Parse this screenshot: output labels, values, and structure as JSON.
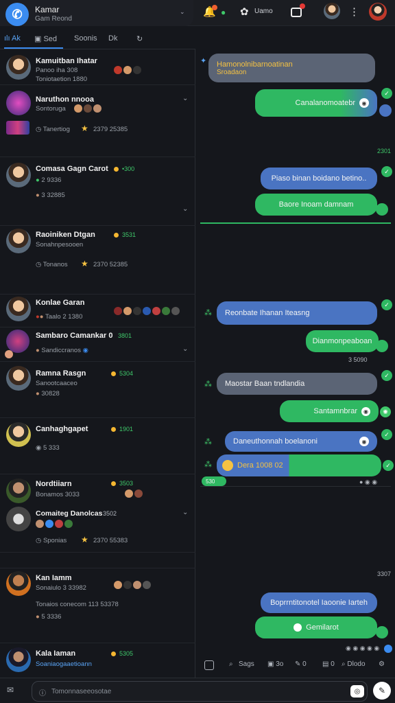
{
  "app": {
    "title": "Kamar",
    "subtitle": "Gam Reond"
  },
  "topbar": {
    "text1": "Uamo",
    "badge_color": "#e53935"
  },
  "tabs": [
    "Ak",
    "Sed",
    "Soonis",
    "Dk"
  ],
  "list": [
    {
      "name": "Kamuitban Ihatar",
      "line1": "Panoo iha 308",
      "line2": "Toniotaetion 1880"
    },
    {
      "name": "Naruthon nnooa",
      "line1": "Sontoruga",
      "meta": "Tanertiog",
      "stars": "2379 25385"
    },
    {
      "name": "Comasa Gagn Carot",
      "status": "•300",
      "line1": "2 9336",
      "line2": "3 32885"
    },
    {
      "name": "Raoiniken Dtgan",
      "status": "3531",
      "line1": "Sonahnpesooen",
      "meta": "Tonanos",
      "stars": "2370 52385"
    },
    {
      "name": "Konlae Garan",
      "line1": "Taalo 2 1380"
    },
    {
      "name": "Sambaro Camankar 0",
      "status": "3801",
      "line1": "Sandiccranos"
    },
    {
      "name": "Ramna Rasgn",
      "status": "5304",
      "line1": "Sanootcaaceo",
      "line2": "30828"
    },
    {
      "name": "Canhaghgapet",
      "status": "1901",
      "line1": "5 333"
    },
    {
      "name": "Nordtiiarn",
      "status": "3503",
      "line1": "Bonamos 3033"
    },
    {
      "name": "Comaiteg Danolcas",
      "status": "3502",
      "meta": "Sponias",
      "stars": "2370 55383"
    },
    {
      "name": "Kan Iamm",
      "line1": "Sonaiulo 3 33982",
      "line2": "Tonaios conecom 113 53378",
      "line3": "5 3336"
    },
    {
      "name": "Kala Iaman",
      "status": "5305",
      "line1": "Soaniaogaaetioann"
    }
  ],
  "chat": {
    "m1": "Hamonolnibarnoatinan",
    "m1b": "Sroadaon",
    "m2": "Canalanomoatebr",
    "meta1": "2301",
    "m3": "Piaso binan boidano betino..",
    "m4": "Baore Inoam damnam",
    "m5": "Reonbate Ihanan Iteasng",
    "m6": "Dianmonpeaboan",
    "meta2": "3 5090",
    "m7": "Maostar Baan tndlandia",
    "m8": "Santamnbrar",
    "m9": "Daneuthonnah boelanoni",
    "m10": "Dera 1008 02",
    "m10b": "530",
    "meta3": "3307",
    "m11": "Boprrntitonotel Iaoonie Iarteh",
    "m12": "Gemilarot"
  },
  "chatbar": {
    "a": "Sags",
    "b": "3o",
    "c": "0",
    "d": "Dlodo"
  },
  "composer": {
    "placeholder": "Tomonnaseeosotae"
  }
}
